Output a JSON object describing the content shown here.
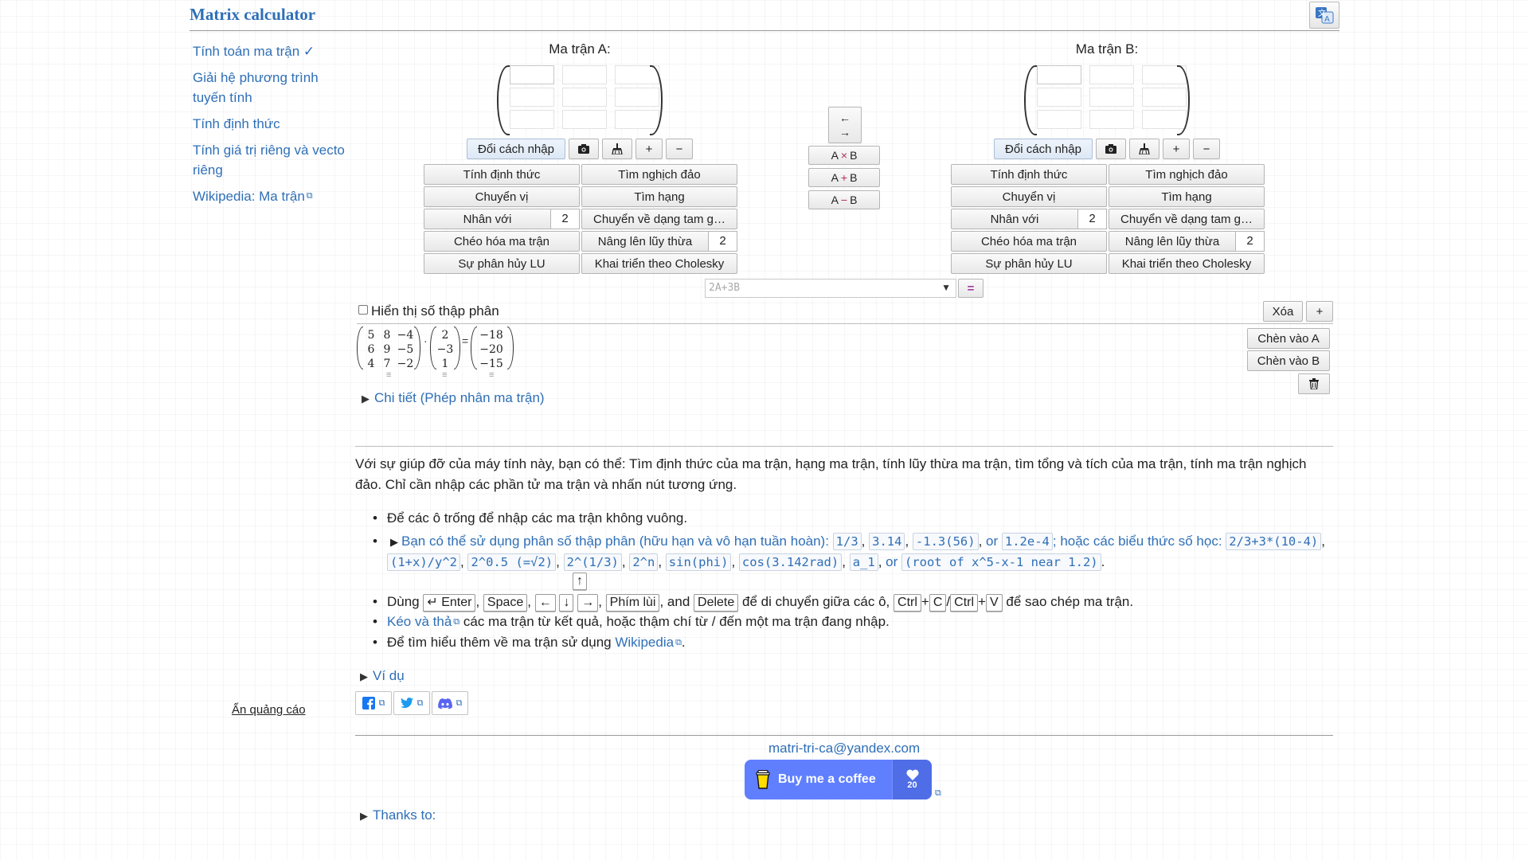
{
  "header": {
    "title": "Matrix calculator"
  },
  "sidebar": {
    "items": [
      {
        "label": "Tính toán ma trận ✓"
      },
      {
        "label": "Giải hệ phương trình tuyến tính"
      },
      {
        "label": "Tính định thức"
      },
      {
        "label": "Tính giá trị riêng và vecto riêng"
      },
      {
        "label": "Wikipedia: Ma trận"
      }
    ],
    "hide_ads": "Ẩn quảng cáo"
  },
  "matrixA": {
    "title": "Ma trận A:",
    "mode": "Đổi cách nhập",
    "plus": "+",
    "minus": "−",
    "ops": {
      "det": "Tính định thức",
      "inverse": "Tìm nghịch đảo",
      "transpose": "Chuyển vị",
      "rank": "Tìm hạng",
      "multiply": "Nhân với",
      "multiply_value": "2",
      "triangular": "Chuyển về dạng tam g…",
      "diagonalize": "Chéo hóa ma trận",
      "power": "Nâng lên lũy thừa",
      "power_value": "2",
      "lu": "Sự phân hủy LU",
      "cholesky": "Khai triển theo Cholesky"
    }
  },
  "matrixB": {
    "title": "Ma trận B:",
    "mode": "Đổi cách nhập",
    "plus": "+",
    "minus": "−",
    "ops": {
      "det": "Tính định thức",
      "inverse": "Tìm nghịch đảo",
      "transpose": "Chuyển vị",
      "rank": "Tìm hạng",
      "multiply": "Nhân với",
      "multiply_value": "2",
      "triangular": "Chuyển về dạng tam g…",
      "diagonalize": "Chéo hóa ma trận",
      "power": "Nâng lên lũy thừa",
      "power_value": "2",
      "lu": "Sự phân hủy LU",
      "cholesky": "Khai triển theo Cholesky"
    }
  },
  "middle": {
    "swap_left": "←",
    "swap_right": "→",
    "mul": {
      "a": "A",
      "op": "×",
      "b": "B"
    },
    "add": {
      "a": "A",
      "op": "+",
      "b": "B"
    },
    "sub": {
      "a": "A",
      "op": "−",
      "b": "B"
    },
    "expr_placeholder": "2A+3B",
    "expr_arrow": "▼",
    "equals": "="
  },
  "results": {
    "decimal_label": "Hiển thị số thập phân",
    "clear": "Xóa",
    "add": "+",
    "insert_a": "Chèn vào A",
    "insert_b": "Chèn vào B",
    "delete_icon": "🗑",
    "dot": "·",
    "eq": "=",
    "handle": "≡",
    "m1": [
      [
        "5",
        "8",
        "−4"
      ],
      [
        "6",
        "9",
        "−5"
      ],
      [
        "4",
        "7",
        "−2"
      ]
    ],
    "m2": [
      [
        "2"
      ],
      [
        "−3"
      ],
      [
        "1"
      ]
    ],
    "m3": [
      [
        "−18"
      ],
      [
        "−20"
      ],
      [
        "−15"
      ]
    ],
    "details": "Chi tiết (Phép nhân ma trận)"
  },
  "info": {
    "intro": "Với sự giúp đỡ của máy tính này, bạn có thể: Tìm định thức của ma trận, hạng ma trận, tính lũy thừa ma trận, tìm tổng và tích của ma trận, tính ma trận nghịch đảo. Chỉ cần nhập các phần tử ma trận và nhấn nút tương ứng.",
    "tip1": "Để các ô trống để nhập các ma trận không vuông.",
    "tip2_prefix": "Bạn có thể sử dụng phân số thập phân (hữu hạn và vô hạn tuần hoàn):",
    "codes1": [
      "1/3",
      "3.14",
      "-1.3(56)",
      "1.2e-4"
    ],
    "or": "or",
    "tip2_mid": "; hoặc các biểu thức số học:",
    "codes2": [
      "2/3+3*(10-4)",
      "(1+x)/y^2",
      "2^0.5 (=√2)",
      "2^(1/3)",
      "2^n",
      "sin(phi)",
      "cos(3.142rad)",
      "a_1",
      "(root of x^5-x-1 near 1.2)"
    ],
    "use": "Dùng",
    "keys": {
      "enter": "↵ Enter",
      "space": "Space",
      "left": "←",
      "up": "↑",
      "down": "↓",
      "right": "→",
      "backspace": "Phím lùi",
      "delete": "Delete",
      "ctrl": "Ctrl",
      "c": "C",
      "v": "V"
    },
    "and": ", and",
    "nav_text": "để di chuyển giữa các ô,",
    "copy_text": "để sao chép ma trận.",
    "drag_link": "Kéo và thả",
    "drag_text": "các ma trận từ kết quả, hoặc thậm chí từ / đến một ma trận đang nhập.",
    "learn_text": "Để tìm hiểu thêm về ma trận sử dụng",
    "wiki_link": "Wikipedia",
    "examples": "Ví dụ"
  },
  "footer": {
    "email": "matri-tri-ca@yandex.com",
    "coffee": "Buy me a coffee",
    "coffee_count": "20",
    "thanks": "Thanks to:"
  }
}
